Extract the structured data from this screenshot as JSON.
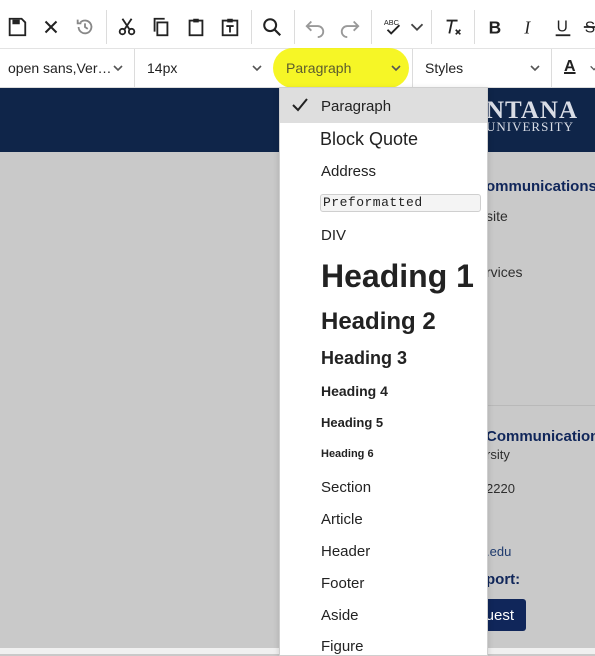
{
  "toolbar": {
    "buttons": [
      "save-icon",
      "close-icon",
      "history-icon",
      "cut-icon",
      "copy-icon",
      "paste-icon",
      "paste-text-icon",
      "find-icon",
      "undo-icon",
      "redo-icon",
      "spellcheck-icon",
      "clear-format-icon",
      "bold-icon",
      "italic-icon",
      "underline-icon",
      "strikethrough-icon"
    ],
    "font_family": "open sans,Ver…",
    "font_size": "14px",
    "format": "Paragraph",
    "styles": "Styles",
    "text_color_label": "A"
  },
  "page": {
    "logo_line1": "NTANA",
    "logo_line2": "UNIVERSITY",
    "texts": [
      "ommunications",
      "site",
      "rvices",
      "Communication",
      "rsity",
      "2220",
      ".edu",
      "port:"
    ],
    "request_button": "uest"
  },
  "dropdown": {
    "selected": "Paragraph",
    "items": [
      "Paragraph",
      "Block Quote",
      "Address",
      "Preformatted",
      "DIV",
      "Heading 1",
      "Heading 2",
      "Heading 3",
      "Heading 4",
      "Heading 5",
      "Heading 6",
      "Section",
      "Article",
      "Header",
      "Footer",
      "Aside",
      "Figure"
    ]
  },
  "colors": {
    "navy": "#0f2549",
    "heading": "#1e3a6e",
    "highlight": "#f5f500"
  }
}
